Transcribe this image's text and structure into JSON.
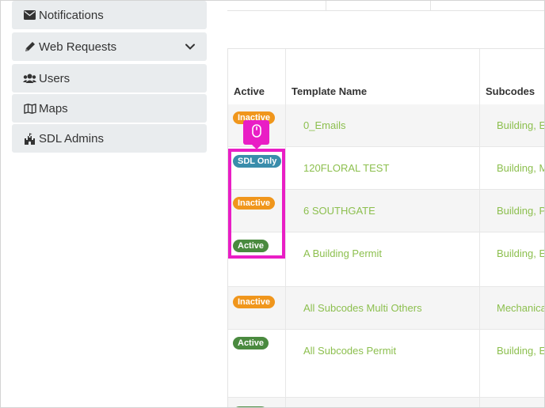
{
  "colors": {
    "inactive": "#f0961c",
    "active": "#4a8a3f",
    "sdl_only": "#3a8dab",
    "link": "#8cbf4e",
    "highlight": "#e91ec5",
    "sidebar_bg": "#e9ecee"
  },
  "sidebar": {
    "items": [
      {
        "label": "Notifications",
        "icon": "envelope-icon"
      },
      {
        "label": "Web Requests",
        "icon": "pencil-icon",
        "expandable": true
      },
      {
        "label": "Users",
        "icon": "users-icon"
      },
      {
        "label": "Maps",
        "icon": "map-icon"
      },
      {
        "label": "SDL Admins",
        "icon": "castle-icon"
      }
    ]
  },
  "table": {
    "headers": {
      "active": "Active",
      "template_name": "Template Name",
      "subcodes": "Subcodes"
    },
    "rows": [
      {
        "status": "Inactive",
        "name": "0_Emails",
        "subcodes": "Building, El"
      },
      {
        "status": "SDL Only",
        "name": "120FLORAL TEST",
        "subcodes": "Building, M"
      },
      {
        "status": "Inactive",
        "name": "6 SOUTHGATE",
        "subcodes": "Building, Pl"
      },
      {
        "status": "Active",
        "name": "A Building Permit",
        "subcodes": "Building, El"
      },
      {
        "status": "Inactive",
        "name": "All Subcodes Multi Others",
        "subcodes": "Mechanica"
      },
      {
        "status": "Active",
        "name": "All Subcodes Permit",
        "subcodes": "Building, El"
      }
    ]
  },
  "overlay": {
    "cursor_icon": "mouse-icon"
  }
}
